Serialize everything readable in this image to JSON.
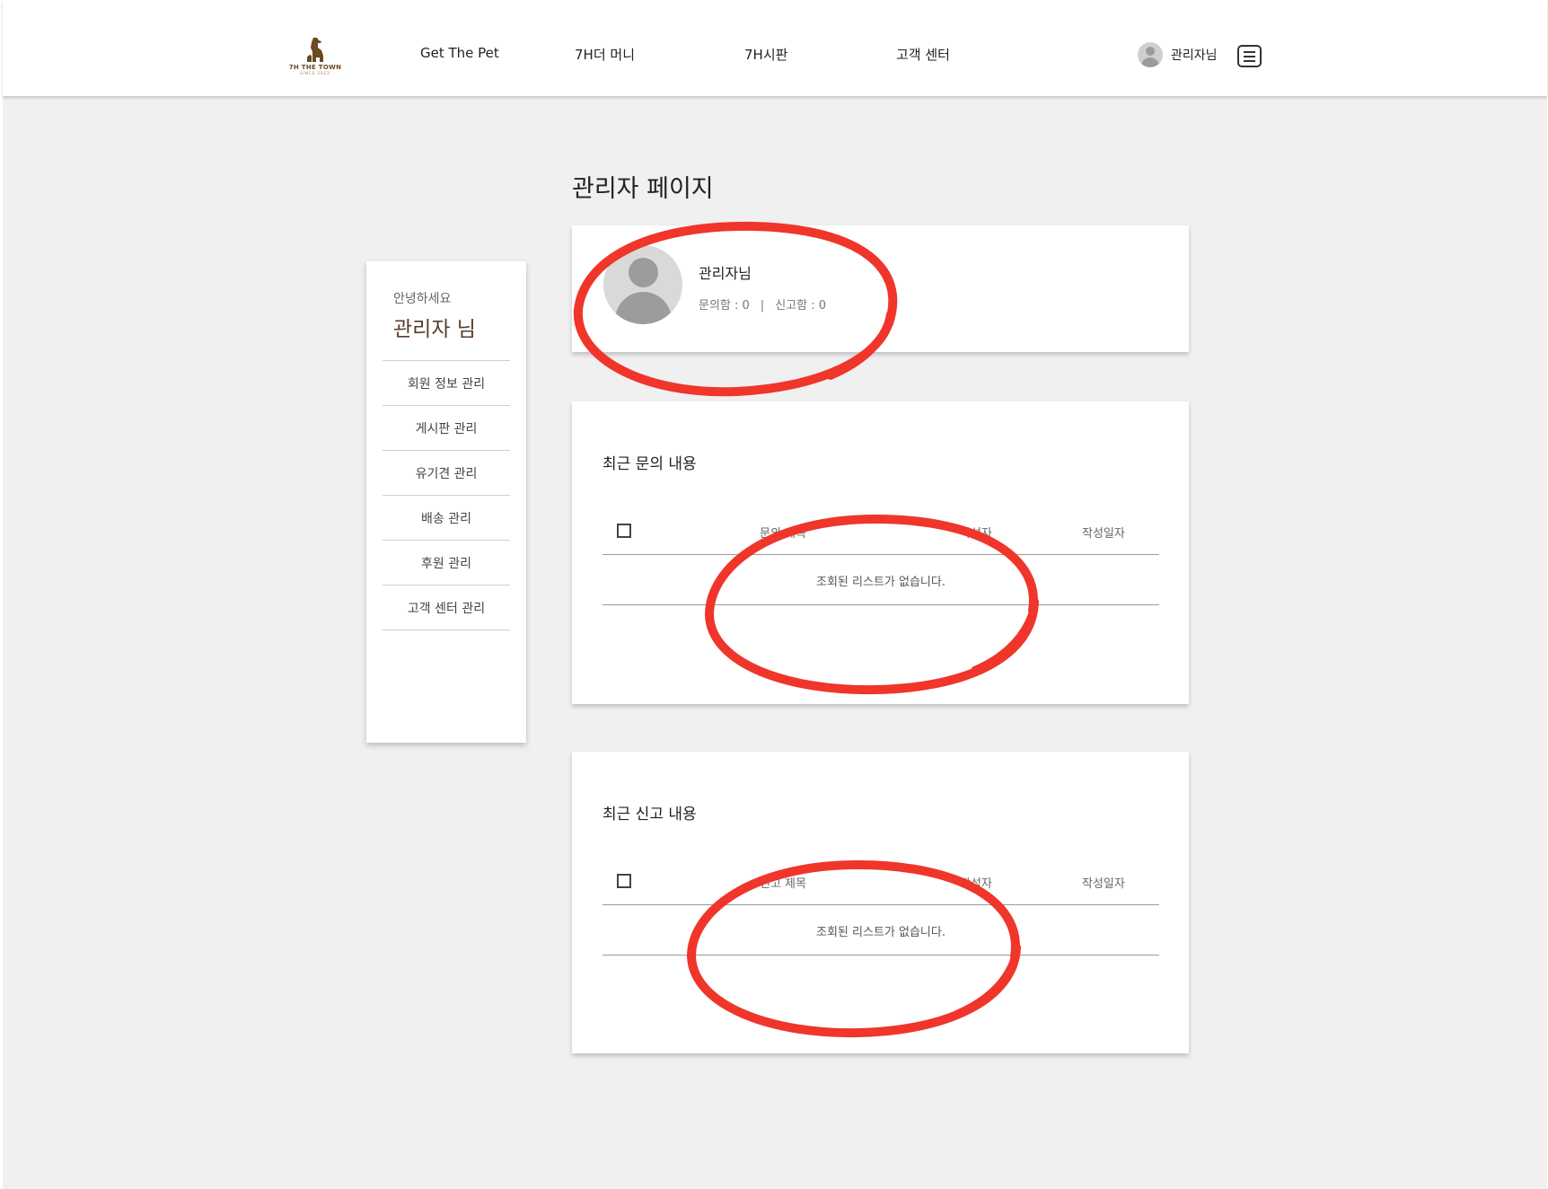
{
  "header": {
    "logo": {
      "brand": "7H THE TOWN",
      "tagline": "SINCE 2022"
    },
    "nav": [
      "Get The Pet",
      "7H더 머니",
      "7H시판",
      "고객 센터"
    ],
    "user_label": "관리자님",
    "icons": {
      "avatar": "user-avatar-icon",
      "menu": "hamburger-menu-icon"
    }
  },
  "page": {
    "title": "관리자 페이지"
  },
  "sidebar": {
    "greeting": "안녕하세요",
    "name": "관리자 님",
    "items": [
      "회원 정보 관리",
      "게시판 관리",
      "유기견 관리",
      "배송 관리",
      "후원 관리",
      "고객 센터 관리"
    ]
  },
  "profile": {
    "name": "관리자님",
    "inquiry_stat": "문의함 : 0",
    "separator": "|",
    "report_stat": "신고함 : 0"
  },
  "inquiries": {
    "title": "최근 문의 내용",
    "columns": {
      "title": "문의 제목",
      "writer": "작성자",
      "date": "작성일자"
    },
    "empty_text": "조회된 리스트가 없습니다."
  },
  "reports": {
    "title": "최근 신고 내용",
    "columns": {
      "title": "신고 제목",
      "writer": "작성자",
      "date": "작성일자"
    },
    "empty_text": "조회된 리스트가 없습니다."
  },
  "colors": {
    "background": "#f0f0f0",
    "card": "#ffffff",
    "brand_brown": "#6b4a22",
    "annotation_red": "#f0352b"
  }
}
